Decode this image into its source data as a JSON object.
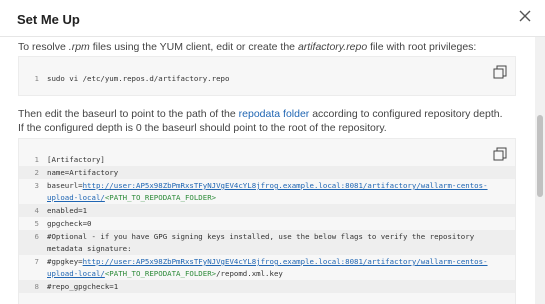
{
  "dialog": {
    "title": "Set Me Up"
  },
  "intro": {
    "prefix": "To resolve ",
    "ext": ".rpm",
    "middle": " files using the YUM client, edit or create the ",
    "file": "artifactory.repo",
    "suffix": " file with root privileges:"
  },
  "block1": {
    "lines": [
      {
        "n": "1",
        "text": "sudo vi /etc/yum.repos.d/artifactory.repo"
      }
    ]
  },
  "edit": {
    "line1_prefix": "Then edit the baseurl to point to the path of the ",
    "line1_link": "repodata folder",
    "line1_suffix": " according to configured repository depth.",
    "line2": "If the configured depth is 0 the baseurl should point to the root of the repository."
  },
  "block2": {
    "l1": {
      "n": "1",
      "text": "[Artifactory]"
    },
    "l2": {
      "n": "2",
      "text": "name=Artifactory"
    },
    "l3": {
      "n": "3",
      "prefix": "baseurl=",
      "url": "http://user:AP5x98ZbPmRxsTFyNJVgEV4cYL8jfrog.example.local:8081/artifactory/wallarm-centos-",
      "url2": "upload-local/",
      "ph": "<PATH_TO_REPODATA_FOLDER>"
    },
    "l4": {
      "n": "4",
      "text": "enabled=1"
    },
    "l5": {
      "n": "5",
      "text": "gpgcheck=0"
    },
    "l6": {
      "n": "6",
      "text": "#Optional - if you have GPG signing keys installed, use the below flags to verify the repository",
      "cont": "metadata signature:"
    },
    "l7": {
      "n": "7",
      "prefix": "#gpgkey=",
      "url": "http://user:AP5x98ZbPmRxsTFyNJVgEV4cYL8jfrog.example.local:8081/artifactory/wallarm-centos-",
      "url2": "upload-local/",
      "ph": "<PATH_TO_REPODATA_FOLDER>",
      "suffix": "/repomd.xml.key"
    },
    "l8": {
      "n": "8",
      "text": "#repo_gpgcheck=1"
    }
  },
  "icons": {
    "close": "close-icon",
    "copy": "copy-icon"
  }
}
